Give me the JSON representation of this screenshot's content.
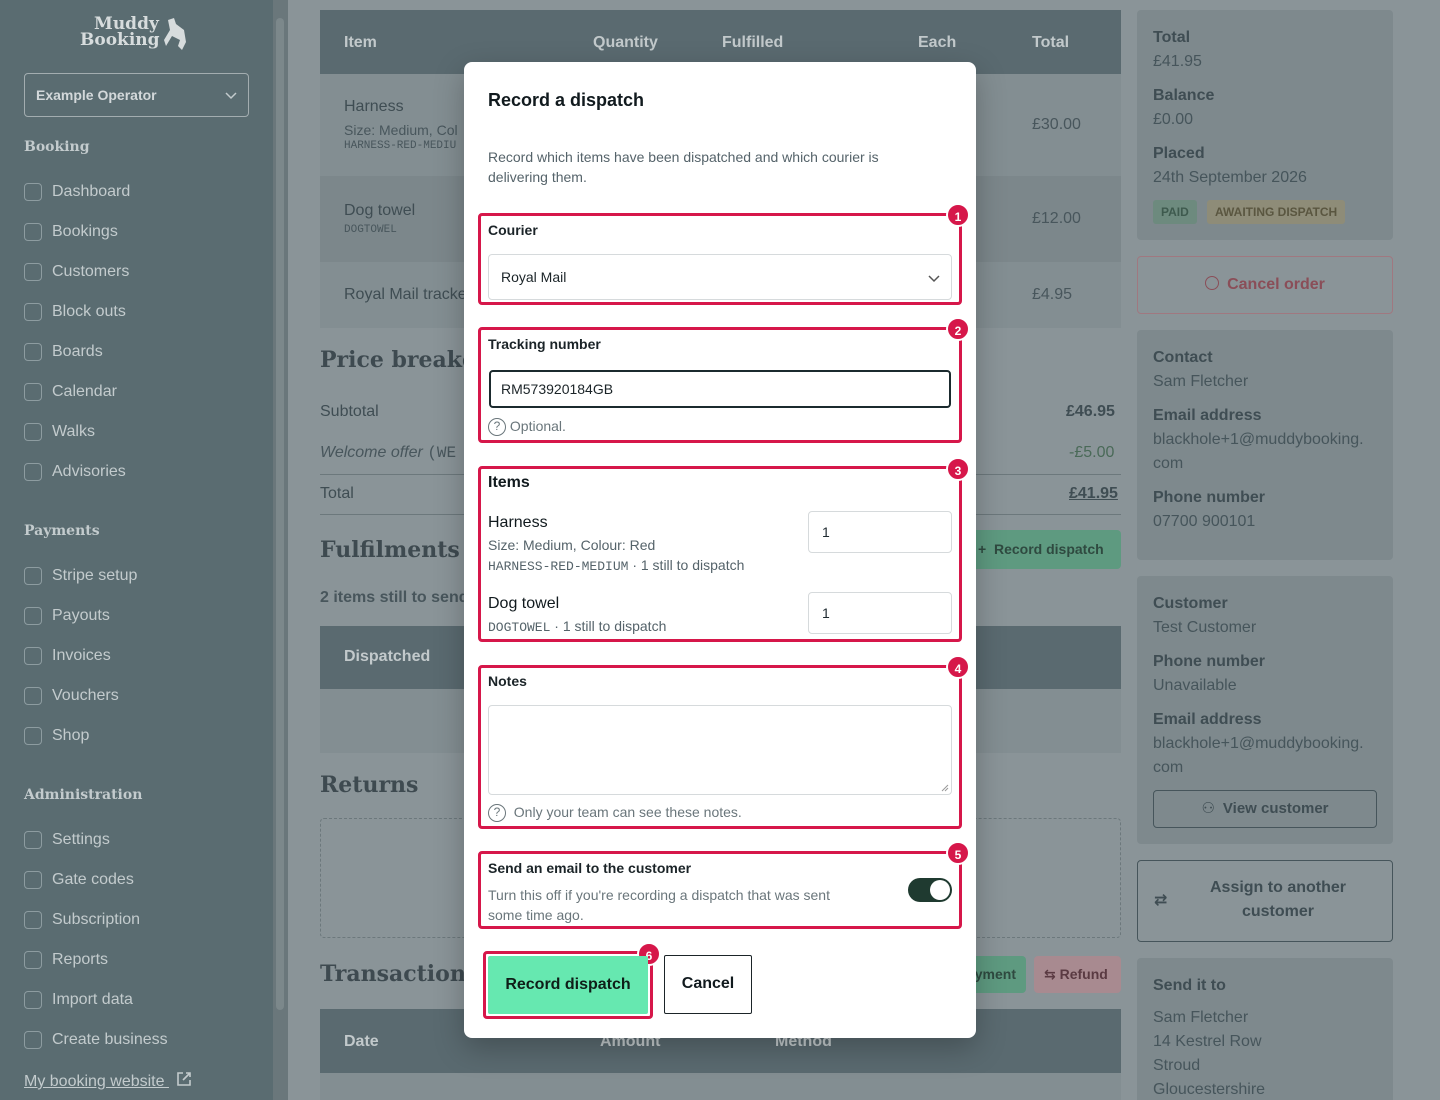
{
  "sidebar": {
    "logo_line1": "Muddy",
    "logo_line2": "Booking",
    "operator": "Example Operator",
    "sections": {
      "booking": "Booking",
      "payments": "Payments",
      "administration": "Administration"
    },
    "booking_items": [
      "Dashboard",
      "Bookings",
      "Customers",
      "Block outs",
      "Boards",
      "Calendar",
      "Walks",
      "Advisories"
    ],
    "payment_items": [
      "Stripe setup",
      "Payouts",
      "Invoices",
      "Vouchers",
      "Shop"
    ],
    "admin_items": [
      "Settings",
      "Gate codes",
      "Subscription",
      "Reports",
      "Import data",
      "Create business"
    ],
    "website_link": "My booking website"
  },
  "items_table": {
    "headers": {
      "item": "Item",
      "quantity": "Quantity",
      "fulfilled": "Fulfilled",
      "each": "Each",
      "total": "Total"
    },
    "rows": [
      {
        "name": "Harness",
        "detail": "Size: Medium, Col",
        "sku": "HARNESS-RED-MEDIU",
        "total": "£30.00"
      },
      {
        "name": "Dog towel",
        "sku": "DOGTOWEL",
        "total": "£12.00"
      },
      {
        "name": "Royal Mail tracke",
        "total": "£4.95"
      }
    ]
  },
  "price": {
    "heading": "Price breake",
    "subtotal_label": "Subtotal",
    "subtotal": "£46.95",
    "offer_label": "Welcome offer",
    "offer_code": "(WE",
    "offer": "-£5.00",
    "total_label": "Total",
    "total": "£41.95"
  },
  "fulfilments": {
    "heading": "Fulfilments",
    "record_button": "Record dispatch",
    "still": "2 items still to send",
    "dispatched_header": "Dispatched"
  },
  "returns": {
    "heading": "Returns"
  },
  "transactions": {
    "heading": "Transaction",
    "payment_button": "yment",
    "refund_button": "Refund",
    "headers": {
      "date": "Date",
      "amount": "Amount",
      "method": "Method"
    }
  },
  "summary": {
    "total_label": "Total",
    "total": "£41.95",
    "balance_label": "Balance",
    "balance": "£0.00",
    "placed_label": "Placed",
    "placed": "24th September 2026",
    "badge_paid": "PAID",
    "badge_status": "AWAITING DISPATCH"
  },
  "cancel_order": "Cancel order",
  "contact": {
    "label": "Contact",
    "name": "Sam Fletcher",
    "email_label": "Email address",
    "email1": "blackhole+1@muddybooking.",
    "email2": "com",
    "phone_label": "Phone number",
    "phone": "07700 900101"
  },
  "customer": {
    "label": "Customer",
    "name": "Test Customer",
    "phone_label": "Phone number",
    "phone": "Unavailable",
    "email_label": "Email address",
    "email1": "blackhole+1@muddybooking.",
    "email2": "com",
    "view_button": "View customer"
  },
  "assign": {
    "line1": "Assign to another",
    "line2": "customer"
  },
  "send_to": {
    "label": "Send it to",
    "lines": [
      "Sam Fletcher",
      "14 Kestrel Row",
      "Stroud",
      "Gloucestershire"
    ]
  },
  "modal": {
    "title": "Record a dispatch",
    "description_line1": "Record which items have been dispatched and which courier is",
    "description_line2": "delivering them.",
    "courier": {
      "label": "Courier",
      "value": "Royal Mail"
    },
    "tracking": {
      "label": "Tracking number",
      "value": "RM573920184GB",
      "help": "Optional."
    },
    "items": {
      "label": "Items",
      "list": [
        {
          "name": "Harness",
          "detail": "Size: Medium, Colour: Red",
          "sku": "HARNESS-RED-MEDIUM",
          "remaining": " · 1 still to dispatch",
          "qty": "1"
        },
        {
          "name": "Dog towel",
          "sku": "DOGTOWEL",
          "remaining": " · 1 still to dispatch",
          "qty": "1"
        }
      ]
    },
    "notes": {
      "label": "Notes",
      "value": "",
      "help": "Only your team can see these notes."
    },
    "email": {
      "label": "Send an email to the customer",
      "help_line1": "Turn this off if you're recording a dispatch that was sent",
      "help_line2": "some time ago.",
      "enabled": true
    },
    "submit": "Record dispatch",
    "cancel": "Cancel",
    "badges": [
      "1",
      "2",
      "3",
      "4",
      "5",
      "6"
    ]
  },
  "colors": {
    "highlight": "#d6174a",
    "primary_button": "#66e8b0",
    "toggle_on": "#1f3a30"
  }
}
